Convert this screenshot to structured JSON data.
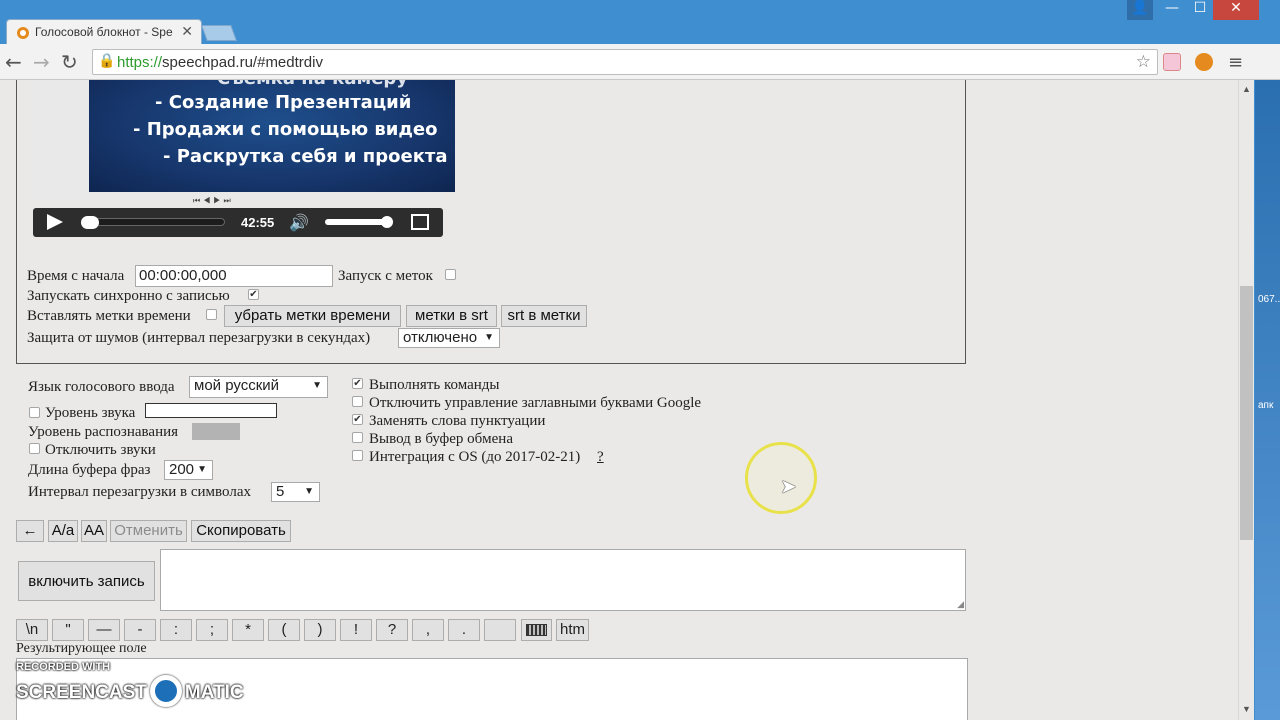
{
  "browser": {
    "tab_title": "Голосовой блокнот - Spe",
    "tab_close": "✕",
    "url_scheme": "https://",
    "url_rest": "speechpad.ru/#medtrdiv",
    "window_user": "👤",
    "window_min": "—",
    "window_max": "☐",
    "window_close": "✕"
  },
  "icons": {
    "back": "←",
    "forward": "→",
    "reload": "↻",
    "lock": "🔒",
    "star": "☆",
    "menu": "≡",
    "play": "▶",
    "speaker": "🔊"
  },
  "video": {
    "slide_lines": [
      "Съемка на камеру",
      "-   Создание Презентаций",
      "-   Продажи с помощью видео",
      "- Раскрутка себя и проекта"
    ],
    "mini_controls": "⏮◀▶⏭",
    "time": "42:55",
    "progress_fraction": 0.05,
    "volume_fraction": 0.9
  },
  "timing": {
    "start_label": "Время с начала",
    "start_value": "00:00:00,000",
    "launch_from_marks_label": "Запуск с меток",
    "launch_from_marks_checked": false,
    "sync_label": "Запускать синхронно с записью",
    "sync_checked": true,
    "insert_marks_label": "Вставлять метки времени",
    "insert_marks_checked": false,
    "remove_marks_button": "убрать метки времени",
    "marks_to_srt_button": "метки в srt",
    "srt_to_marks_button": "srt в метки",
    "noise_label": "Защита от шумов (интервал перезагрузки в секундах)",
    "noise_value": "отключено"
  },
  "settings_left": {
    "language_label": "Язык голосового ввода",
    "language_value": "мой русский",
    "sound_level_label": "Уровень звука",
    "recognition_level_label": "Уровень распознавания",
    "mute_label": "Отключить звуки",
    "buffer_label": "Длина буфера фраз",
    "buffer_value": "200",
    "reload_interval_label": "Интервал перезагрузки в символах",
    "reload_interval_value": "5"
  },
  "settings_right": {
    "items": [
      {
        "label": "Выполнять команды",
        "checked": true
      },
      {
        "label": "Отключить управление заглавными буквами Google",
        "checked": false
      },
      {
        "label": "Заменять слова пунктуации",
        "checked": true
      },
      {
        "label": "Вывод в буфер обмена",
        "checked": false
      },
      {
        "label": "Интеграция с OS (до 2017-02-21)",
        "checked": false
      }
    ],
    "integration_help": "?"
  },
  "edit_buttons": {
    "back": "←",
    "case_toggle": "А/а",
    "upper": "АА",
    "undo": "Отменить",
    "copy": "Скопировать"
  },
  "record": {
    "button": "включить запись"
  },
  "punctuation_buttons": [
    "\\n",
    "\"",
    "—",
    "-",
    ":",
    ";",
    "*",
    "(",
    ")",
    "!",
    "?",
    ",",
    ".",
    ""
  ],
  "html_button": "htm",
  "result": {
    "label": "Результирующее поле"
  },
  "watermark": {
    "line1": "RECORDED WITH",
    "brand_left": "SCREENCAST",
    "brand_right": "MATIC"
  },
  "desktop_fragments": [
    "067..",
    "апк"
  ],
  "colors": {
    "titlebar": "#3f8ed0",
    "close_button": "#c7463d",
    "page_background": "#ebe9e7",
    "secure_url": "#2d9b2d",
    "cursor_highlight": "#e8e14a"
  }
}
